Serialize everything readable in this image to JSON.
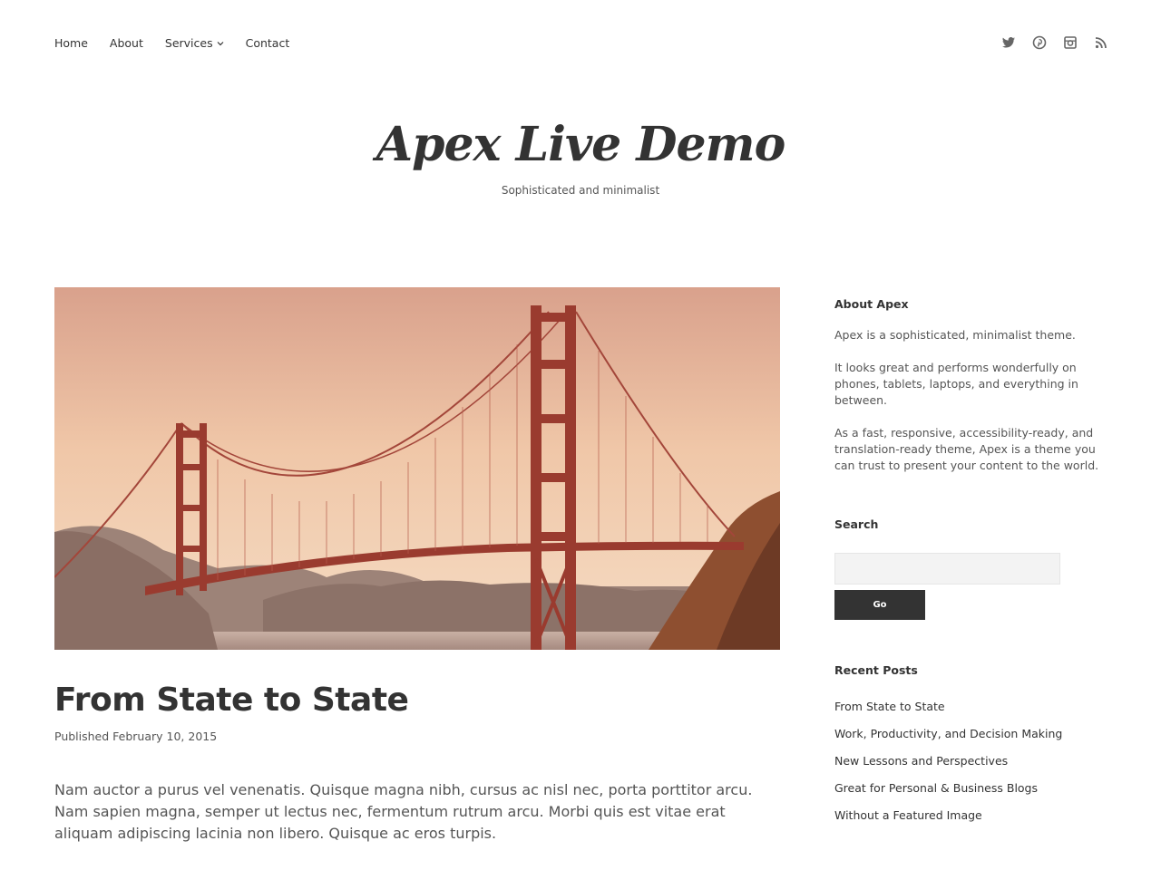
{
  "nav": {
    "items": [
      {
        "label": "Home"
      },
      {
        "label": "About"
      },
      {
        "label": "Services",
        "has_dropdown": true
      },
      {
        "label": "Contact"
      }
    ],
    "social_icons": [
      "twitter-icon",
      "pinterest-icon",
      "instagram-icon",
      "rss-icon"
    ]
  },
  "header": {
    "title": "Apex Live Demo",
    "tagline": "Sophisticated and minimalist"
  },
  "post": {
    "title": "From State to State",
    "meta": "Published February 10, 2015",
    "excerpt": "Nam auctor a purus vel venenatis. Quisque magna nibh, cursus ac nisl nec, porta porttitor arcu. Nam sapien magna, semper ut lectus nec, fermentum rutrum arcu. Morbi quis est vitae erat aliquam adipiscing lacinia non libero. Quisque ac eros turpis."
  },
  "sidebar": {
    "about": {
      "title": "About Apex",
      "paragraphs": [
        "Apex is a sophisticated, minimalist theme.",
        "It looks great and performs wonderfully on phones, tablets, laptops, and everything in between.",
        "As a fast, responsive, accessibility-ready, and translation-ready theme, Apex is a theme you can trust to present your content to the world."
      ]
    },
    "search": {
      "title": "Search",
      "placeholder": "",
      "button_label": "Go"
    },
    "recent_posts": {
      "title": "Recent Posts",
      "items": [
        "From State to State",
        "Work, Productivity, and Decision Making",
        "New Lessons and Perspectives",
        "Great for Personal & Business Blogs",
        "Without a Featured Image"
      ]
    }
  },
  "colors": {
    "text": "#333333",
    "muted": "#555555",
    "button_bg": "#333333",
    "input_bg": "#f3f3f3"
  }
}
